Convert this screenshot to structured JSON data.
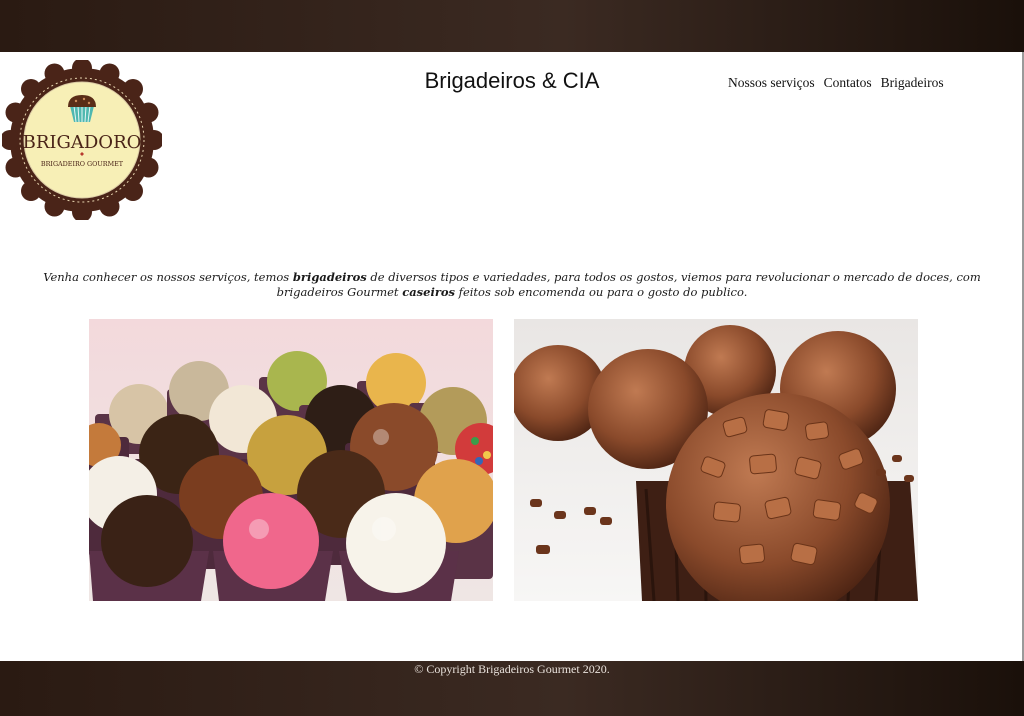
{
  "site": {
    "title": "Brigadeiros & CIA"
  },
  "logo": {
    "brand": "BRIGADORO",
    "tagline": "BRIGADEIRO GOURMET"
  },
  "nav": {
    "items": [
      "Nossos serviços",
      "Contatos",
      "Brigadeiros"
    ]
  },
  "intro": {
    "part1": "Venha conhecer os nossos serviços, temos ",
    "bold1": "brigadeiros",
    "part2": " de diversos tipos e variedades, para todos os gostos, viemos para revolucionar o mercado de doces, com brigadeiros Gourmet ",
    "bold2": "caseiros",
    "part3": " feitos sob encomenda ou para o gosto do publico."
  },
  "footer": {
    "copyright": "© Copyright Brigadeiros Gourmet 2020."
  },
  "colors": {
    "header_bar": "#2a1a12",
    "logo_ring": "#4a2418",
    "logo_center": "#f7efb6",
    "chocolate": "#5a2d17"
  }
}
